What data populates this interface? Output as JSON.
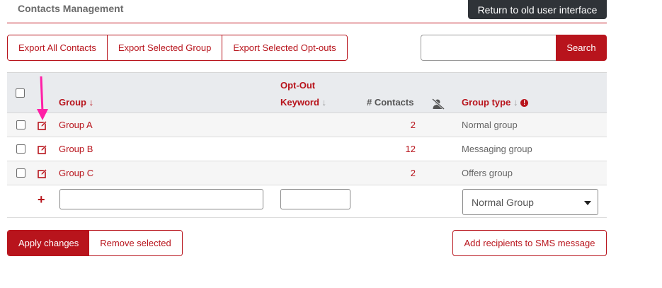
{
  "header": {
    "title": "Contacts Management",
    "old_ui_label": "Return to old user interface"
  },
  "toolbar": {
    "export_all": "Export All Contacts",
    "export_selected_group": "Export Selected Group",
    "export_opt_outs": "Export Selected Opt-outs",
    "search_placeholder": "",
    "search_label": "Search"
  },
  "table": {
    "headers": {
      "group": "Group",
      "opt_out_line1": "Opt-Out",
      "opt_out_line2": "Keyword",
      "contacts": "# Contacts",
      "group_type": "Group type"
    },
    "rows": [
      {
        "name": "Group A",
        "count": "2",
        "type": "Normal group"
      },
      {
        "name": "Group B",
        "count": "12",
        "type": "Messaging group"
      },
      {
        "name": "Group C",
        "count": "2",
        "type": "Offers group"
      }
    ],
    "new_row": {
      "name_value": "",
      "keyword_value": "",
      "type_selected": "Normal Group"
    }
  },
  "actions": {
    "apply": "Apply changes",
    "remove": "Remove selected",
    "add_recipients": "Add recipients to SMS message"
  },
  "colors": {
    "accent": "#b8141c",
    "dark_button": "#2f3338",
    "annotation_arrow": "#ff1fa6"
  },
  "icons": {
    "sort_active": "arrow-down-icon",
    "sort_inactive": "arrow-down-icon",
    "opt_out_column": "user-slash-icon",
    "info": "info-icon",
    "edit": "edit-icon",
    "add": "plus-icon"
  }
}
